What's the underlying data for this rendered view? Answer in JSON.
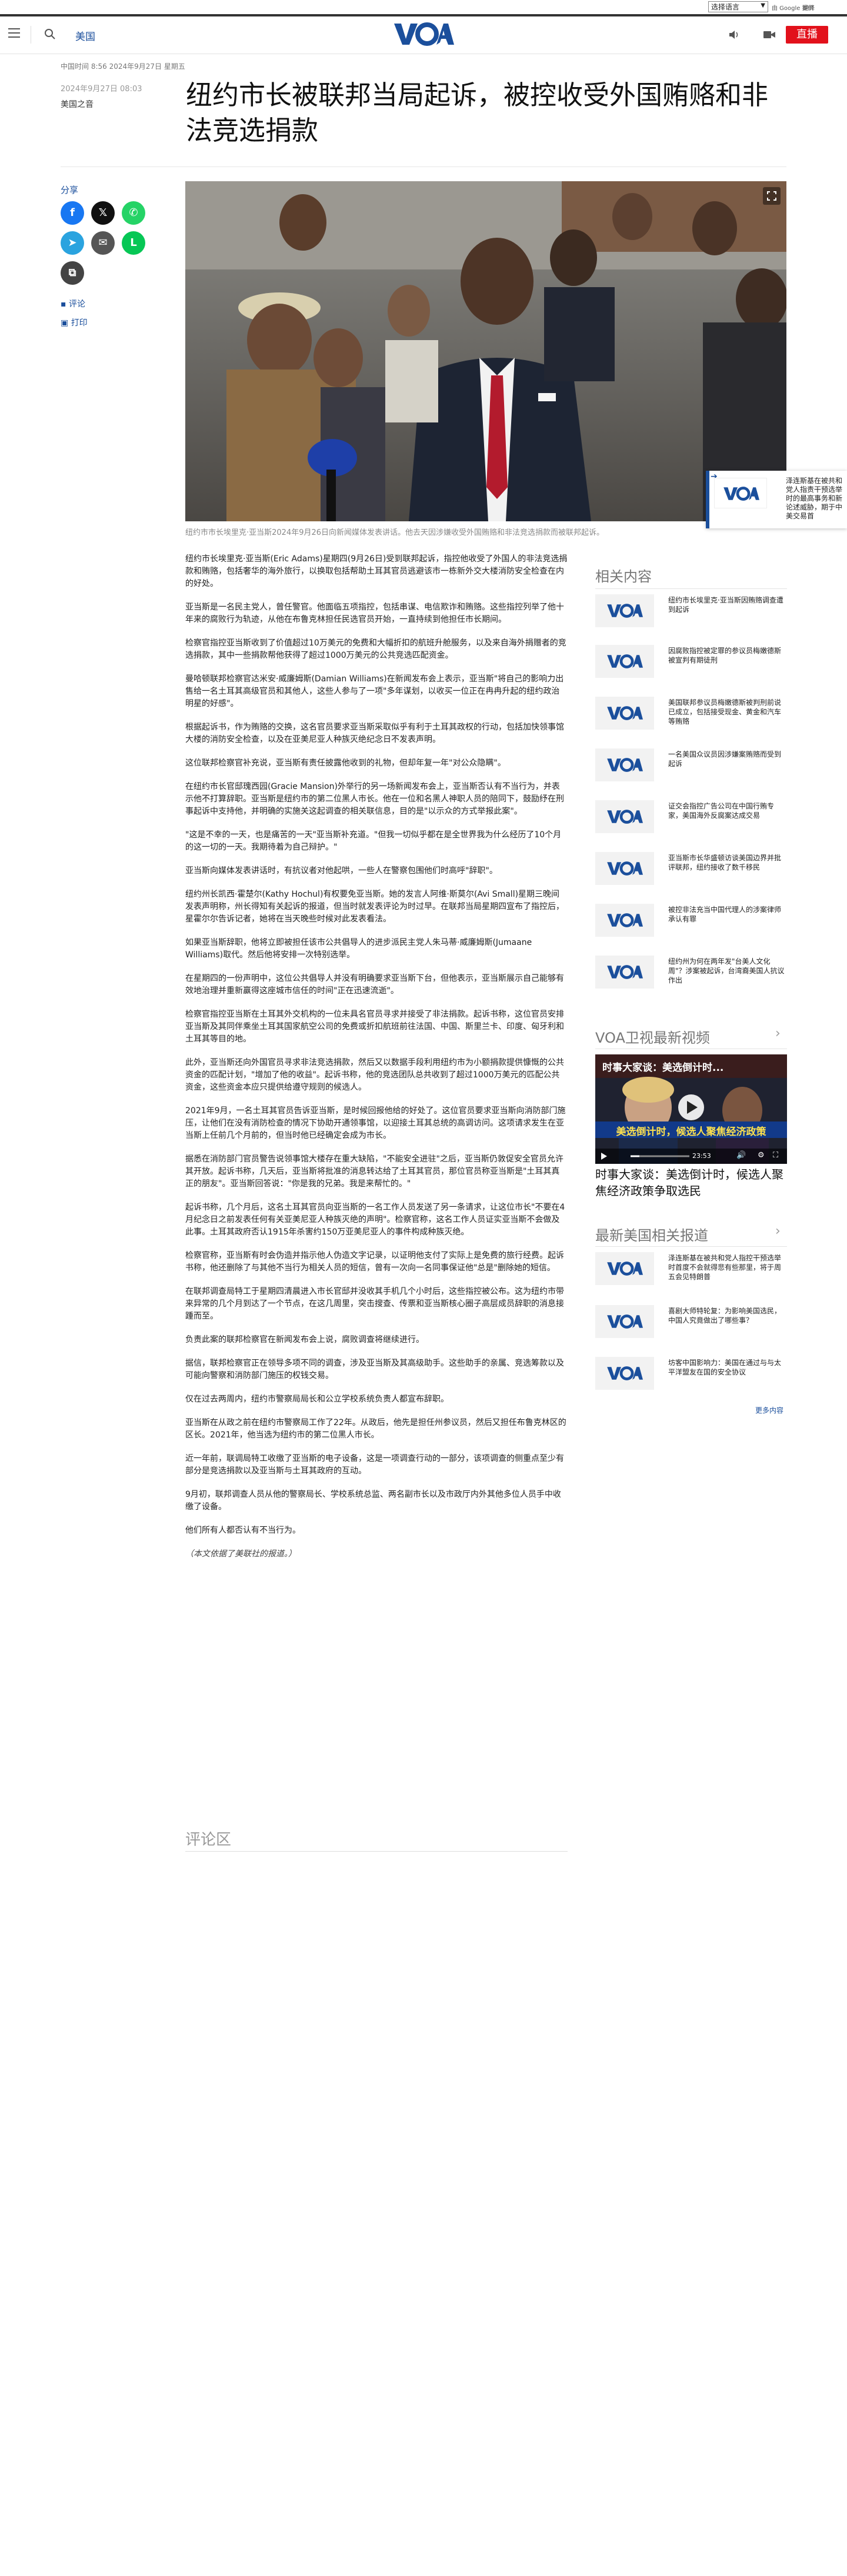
{
  "util": {
    "language": "选择语言",
    "powered_by": "由 Google 提供",
    "translate": "翻译"
  },
  "header": {
    "section": "美国",
    "live": "直播"
  },
  "article": {
    "dateline": "中国时间 8:56 2024年9月27日 星期五",
    "date": "2024年9月27日 08:03",
    "credit": "美国之音",
    "headline": "纽约市长被联邦当局起诉，被控收受外国贿赂和非法竞选捐款",
    "caption": "纽约市市长埃里克·亚当斯2024年9月26日向新闻媒体发表讲话。他去天因涉嫌收受外国贿赂和非法竞选捐款而被联邦起诉。",
    "paragraphs": [
      "纽约市长埃里克·亚当斯(Eric Adams)星期四(9月26日)受到联邦起诉，指控他收受了外国人的非法竞选捐款和贿赂，包括奢华的海外旅行，以换取包括帮助土耳其官员逃避该市一栋新外交大楼消防安全检查在内的好处。",
      "亚当斯是一名民主党人，曾任警官。他面临五项指控，包括串谋、电信欺诈和贿赂。这些指控列举了他十年来的腐败行为轨迹，从他在布鲁克林担任民选官员开始，一直持续到他担任市长期间。",
      "检察官指控亚当斯收到了价值超过10万美元的免费和大幅折扣的航班升舱服务，以及来自海外捐赠者的竞选捐款，其中一些捐款帮他获得了超过1000万美元的公共竞选匹配资金。",
      "曼哈顿联邦检察官达米安·威廉姆斯(Damian Williams)在新闻发布会上表示，亚当斯\"将自己的影响力出售给一名土耳其高级官员和其他人，这些人参与了一项\"多年谋划，以收买一位正在冉冉升起的纽约政治明星的好感\"。",
      "根据起诉书，作为贿赂的交换，这名官员要求亚当斯采取似乎有利于土耳其政权的行动，包括加快领事馆大楼的消防安全检查，以及在亚美尼亚人种族灭绝纪念日不发表声明。",
      "这位联邦检察官补充说，亚当斯有责任披露他收到的礼物，但却年复一年\"对公众隐瞒\"。",
      "在纽约市长官邸瑰西园(Gracie Mansion)外举行的另一场新闻发布会上，亚当斯否认有不当行为，并表示他不打算辞职。亚当斯是纽约市的第二位黑人市长。他在一位和名黑人神职人员的陪同下，鼓励纾在刑事起诉中支持他，并明确的实施关这起调查的相关联信息，目的是\"以示众的方式举报此案\"。",
      "\"这是不幸的一天，也是痛苦的一天\"亚当斯补充道。\"但我一切似乎都在是全世界我为什么经历了10个月的这一切的一天。我期待着为自己辩护。\"",
      "亚当斯向媒体发表讲话时，有抗议者对他起哄，一些人在警察包围他们时高呼\"辞职\"。",
      "纽约州长凯西·霍楚尔(Kathy Hochul)有权要免亚当斯。她的发言人阿维·斯莫尔(Avi Small)星期三晚间发表声明称，州长得知有关起诉的报道，但当时就发表评论为时过早。在联邦当局星期四宣布了指控后，星霍尔尔告诉记者，她将在当天晚些时候对此发表看法。",
      "如果亚当斯辞职，他将立即被担任该市公共倡导人的进步派民主党人朱马蒂·威廉姆斯(Jumaane Williams)取代。然后他将安排一次特别选举。",
      "在星期四的一份声明中，这位公共倡导人并没有明确要求亚当斯下台，但他表示，亚当斯展示自己能够有效地治理并重新赢得这座城市信任的时间\"正在迅速流逝\"。",
      "检察官指控亚当斯在土耳其外交机构的一位未具名官员寻求并接受了非法捐款。起诉书称，这位官员安排亚当斯及其同伴乘坐土耳其国家航空公司的免费或折扣航班前往法国、中国、斯里兰卡、印度、匈牙利和土耳其等目的地。",
      "此外，亚当斯还向外国官员寻求非法竞选捐款，然后又以数据手段利用纽约市为小额捐款提供慷慨的公共资金的匹配计划，\"增加了他的收益\"。起诉书称，他的竞选团队总共收到了超过1000万美元的匹配公共资金，这些资金本应只提供给遵守规则的候选人。",
      "2021年9月，一名土耳其官员告诉亚当斯，是时候回报他给的好处了。这位官员要求亚当斯向消防部门施压，让他们在没有消防检查的情况下协助开通领事馆，以迎接土耳其总统的高调访问。这项请求发生在亚当斯上任前几个月前的，但当时他已经确定会成为市长。",
      "据悉在消防部门官员警告说领事馆大楼存在重大缺陷，\"不能安全进驻\"之后，亚当斯仍敦促安全官员允许其开放。起诉书称，几天后，亚当斯将批准的消息转达给了土耳其官员，那位官员称亚当斯是\"土耳其真正的朋友\"。亚当斯回答说：\"你是我的兄弟。我是来帮忙的。\"",
      "起诉书称，几个月后，这名土耳其官员向亚当斯的一名工作人员发送了另一条请求，让这位市长\"不要在4月纪念日之前发表任何有关亚美尼亚人种族灭绝的声明\"。检察官称，这名工作人员证实亚当斯不会做及此事。土耳其政府否认1915年杀害约150万亚美尼亚人的事件构成种族灭绝。",
      "检察官称，亚当斯有时会伪造并指示他人伪造文字记录，以证明他支付了实际上是免费的旅行经费。起诉书称，他还删除了与其他不当行为相关人员的短信，曾有一次向一名同事保证他\"总是\"删除她的短信。",
      "在联邦调查局特工于星期四清晨进入市长官邸并没收其手机几个小时后，这些指控被公布。这为纽约市带来异常的几个月到达了一个节点，在这几周里，突击搜查、传票和亚当斯核心圈子高层成员辞职的消息接踵而至。",
      "负责此案的联邦检察官在新闻发布会上说，腐败调查将继续进行。",
      "据信，联邦检察官正在领导多项不同的调查，涉及亚当斯及其高级助手。这些助手的亲属、竞选筹款以及可能向警察和消防部门施压的权钱交易。",
      "仅在过去两周内，纽约市警察局局长和公立学校系统负责人都宣布辞职。",
      "亚当斯在从政之前在纽约市警察局工作了22年。从政后，他先是担任州参议员，然后又担任布鲁克林区的区长。2021年，他当选为纽约市的第二位黑人市长。",
      "近一年前，联调局特工收缴了亚当斯的电子设备，这是一项调查行动的一部分，该项调查的侧重点至少有部分是竞选捐款以及亚当斯与土耳其政府的互动。",
      "9月初，联邦调查人员从他的警察局长、学校系统总监、两名副市长以及市政厅内外其他多位人员手中收缴了设备。",
      "他们所有人都否认有不当行为。",
      "（本文依据了美联社的报道。）"
    ],
    "comments_title": "评论区"
  },
  "share": {
    "label": "分享",
    "comments": "评论",
    "print": "打印"
  },
  "sticky": {
    "text": "泽连斯基在被共和党人指责干预选举时的最高事务和新论述威胁，期于中美交易首"
  },
  "sidebar": {
    "related_title": "相关内容",
    "related": [
      "纽约市长埃里克·亚当斯因贿赂调查遭到起诉",
      "因腐败指控被定罪的参议员梅嫩德斯被宣判有期徒刑",
      "美国联邦参议员梅嫩德斯被判刑前说已成立，包括接受现金、黄金和汽车等贿赂",
      "一名美国众议员因涉嫌案贿赂而受到起诉",
      "证交会指控广告公司在中国行贿专家，美国海外反腐案达成交易",
      "亚当斯市长华盛顿访谈美国边界并批评联邦，纽约接收了数千移民",
      "被控非法充当中国代理人的涉案律师承认有罪",
      "纽约州为何在两年发\"台美人文化周\"？涉案被起诉，台湾裔美国人抗议作出"
    ],
    "video_title": "VOA卫视最新视频",
    "video_overlay_top": "时事大家谈：美选倒计时...",
    "video_banner": "美选倒计时，候选人聚焦经济政策",
    "video_time": "23:53",
    "video_caption": "时事大家谈：美选倒计时，候选人聚焦经济政策争取选民",
    "china_title": "最新美国相关报道",
    "china_items": [
      "泽连斯基在被共和党人指控干预选举时首度不会就得悲有些那里，将于周五会见特朗普",
      "喜剧大师特轮复：为影响美国选民，中国人究竟做出了哪些事？",
      "坊客中国影响力：美国在通过与与太平洋盟友在国的安全协议"
    ],
    "more": "更多内容"
  }
}
